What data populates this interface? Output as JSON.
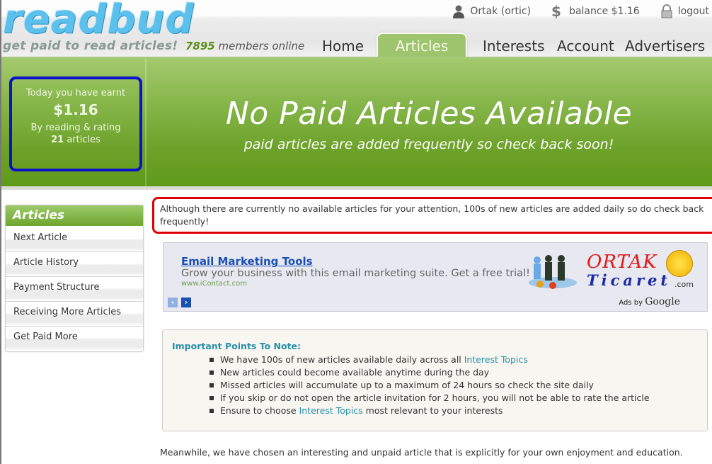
{
  "brand": {
    "logo_text": "readbud",
    "tagline": "get paid to read articles!"
  },
  "userbar": {
    "user": "Ortak (ortic)",
    "balance": "balance $1.16",
    "logout": "logout"
  },
  "members": {
    "count": "7895",
    "label": " members online"
  },
  "nav": {
    "tabs": [
      {
        "label": "Home"
      },
      {
        "label": "Articles",
        "active": true
      },
      {
        "label": "Interests"
      },
      {
        "label": "Account"
      },
      {
        "label": "Advertisers"
      }
    ]
  },
  "earnings": {
    "line1": "Today you have earnt",
    "amount": "$1.16",
    "line3": "By reading & rating",
    "count": "21",
    "count_label": " articles"
  },
  "hero": {
    "title": "No Paid Articles Available",
    "subtitle": "paid articles are added frequently so check back soon!"
  },
  "sidebar": {
    "title": "Articles",
    "items": [
      {
        "label": "Next Article"
      },
      {
        "label": "Article History"
      },
      {
        "label": "Payment Structure"
      },
      {
        "label": "Receiving More Articles"
      },
      {
        "label": "Get Paid More"
      }
    ]
  },
  "notice": {
    "text": "Although there are currently no available articles for your attention, 100s of new articles are added daily so do check back frequently!"
  },
  "ad": {
    "title": "Email Marketing Tools",
    "description": "Grow your business with this email marketing suite. Get a free trial!",
    "url": "www.iContact.com",
    "prev": "‹",
    "next": "›",
    "brand_line1": "ORTAK",
    "brand_line2": "Ticaret",
    "brand_suffix": ".com",
    "ads_by": "Ads by ",
    "ads_by_brand": "Google"
  },
  "points": {
    "title": "Important Points To Note:",
    "items": [
      {
        "text": "We have 100s of new articles available daily across all ",
        "link": "Interest Topics",
        "after": ""
      },
      {
        "text": "New articles could become available anytime during the day",
        "link": "",
        "after": ""
      },
      {
        "text": "Missed articles will accumulate up to a maximum of 24 hours so check the site daily",
        "link": "",
        "after": ""
      },
      {
        "text": "If you skip or do not open the article invitation for 2 hours, you will not be able to rate the article",
        "link": "",
        "after": ""
      },
      {
        "text": "Ensure to choose ",
        "link": "Interest Topics",
        "after": " most relevant to your interests"
      }
    ]
  },
  "meanwhile": {
    "text": "Meanwhile, we have chosen an interesting and unpaid article that is explicitly for your own enjoyment and education."
  },
  "colors": {
    "brand_green": "#6da22a",
    "tab_active": "#9ec46e",
    "highlight_blue": "#0a13c8",
    "highlight_red": "#e00000",
    "link": "#2a8fa8",
    "ad_link": "#1a4fb3"
  }
}
